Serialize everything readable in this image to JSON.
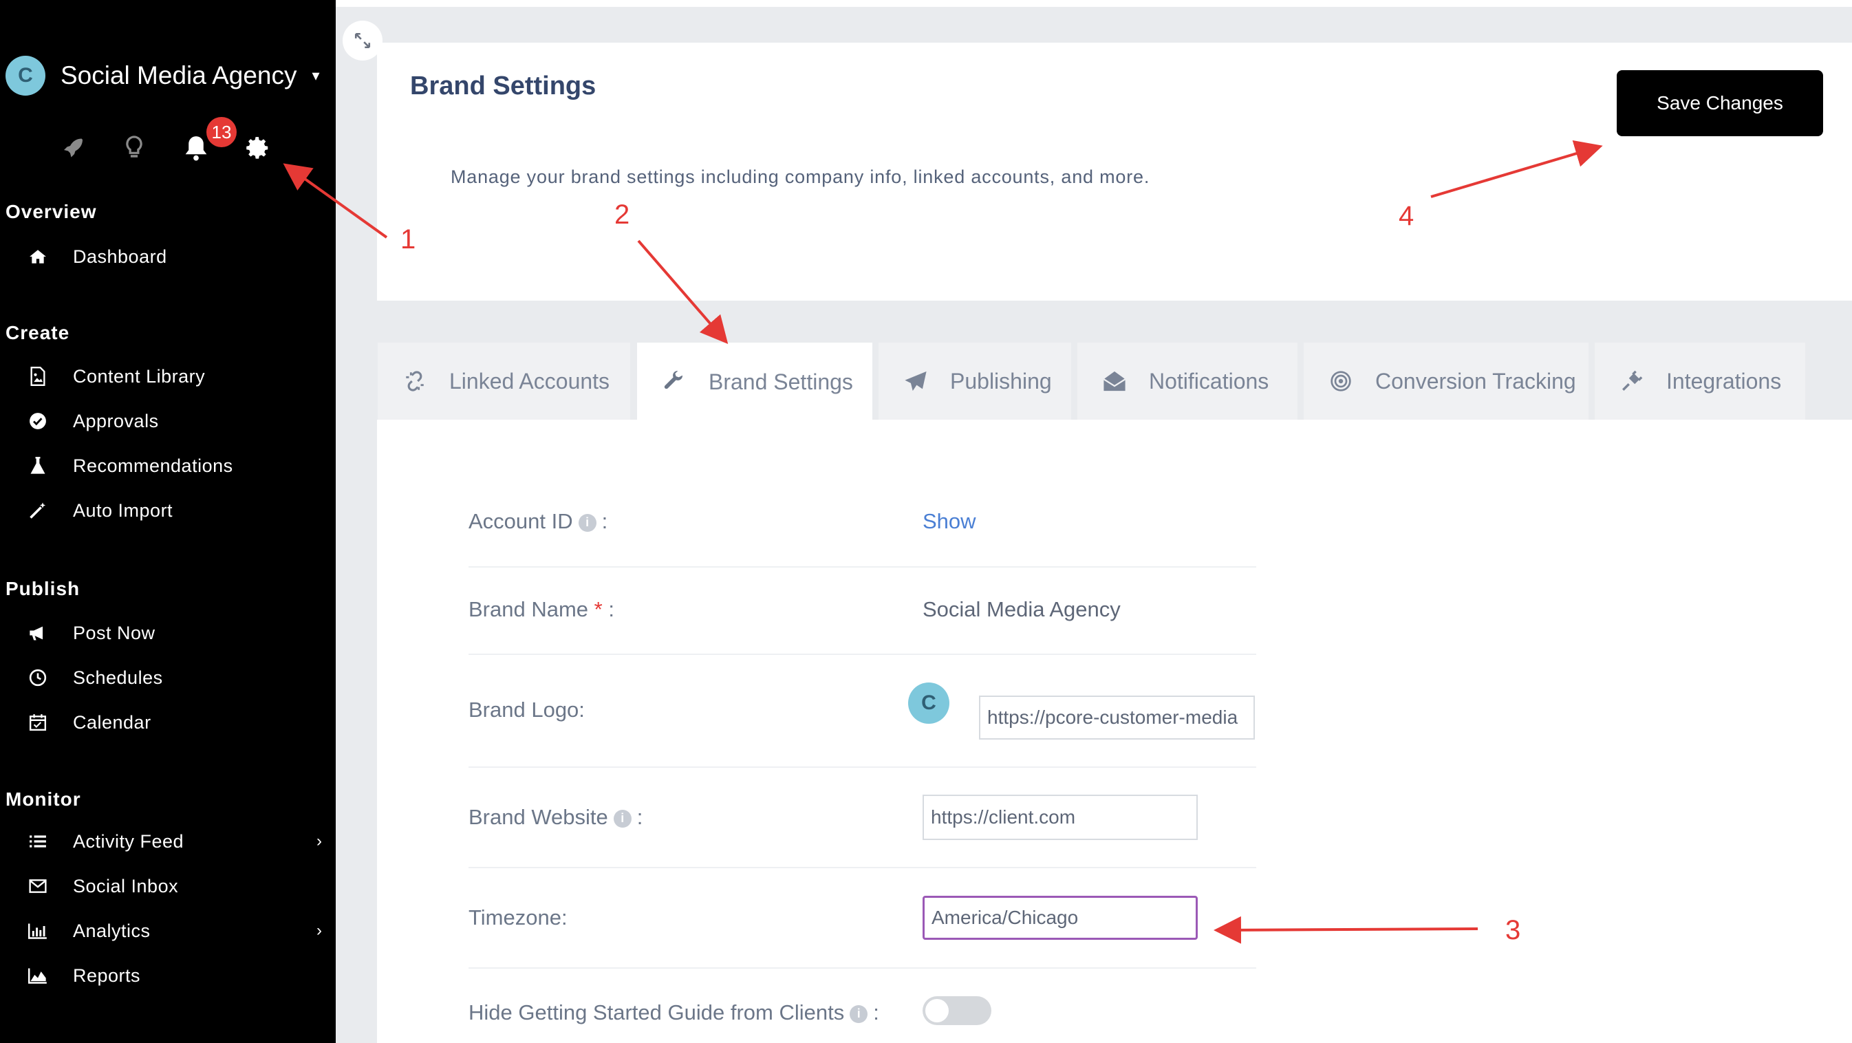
{
  "sidebar": {
    "brand": {
      "avatar_letter": "C",
      "name": "Social Media Agency",
      "caret": "▾"
    },
    "notification_count": "13",
    "sections": [
      {
        "title": "Overview",
        "items": [
          {
            "label": "Dashboard",
            "icon": "home-icon"
          }
        ]
      },
      {
        "title": "Create",
        "items": [
          {
            "label": "Content Library",
            "icon": "file-image-icon"
          },
          {
            "label": "Approvals",
            "icon": "check-circle-icon"
          },
          {
            "label": "Recommendations",
            "icon": "flask-icon"
          },
          {
            "label": "Auto Import",
            "icon": "magic-wand-icon"
          }
        ]
      },
      {
        "title": "Publish",
        "items": [
          {
            "label": "Post Now",
            "icon": "megaphone-icon"
          },
          {
            "label": "Schedules",
            "icon": "clock-icon"
          },
          {
            "label": "Calendar",
            "icon": "calendar-icon"
          }
        ]
      },
      {
        "title": "Monitor",
        "items": [
          {
            "label": "Activity Feed",
            "icon": "list-icon",
            "chevron": "›"
          },
          {
            "label": "Social Inbox",
            "icon": "envelope-icon"
          },
          {
            "label": "Analytics",
            "icon": "bar-chart-icon",
            "chevron": "›"
          },
          {
            "label": "Reports",
            "icon": "area-chart-icon"
          }
        ]
      }
    ]
  },
  "header": {
    "title": "Brand Settings",
    "description": "Manage your brand settings including company info, linked accounts, and more.",
    "save_label": "Save Changes"
  },
  "tabs": [
    {
      "label": "Linked Accounts",
      "icon": "unlink-icon"
    },
    {
      "label": "Brand Settings",
      "icon": "wrench-icon",
      "active": true
    },
    {
      "label": "Publishing",
      "icon": "paper-plane-icon"
    },
    {
      "label": "Notifications",
      "icon": "envelope-open-icon"
    },
    {
      "label": "Conversion Tracking",
      "icon": "target-icon"
    },
    {
      "label": "Integrations",
      "icon": "plug-icon"
    }
  ],
  "form": {
    "account_id": {
      "label": "Account ID",
      "suffix": ":",
      "value": "Show"
    },
    "brand_name": {
      "label": "Brand Name",
      "required": "*",
      "suffix": ":",
      "value": "Social Media Agency"
    },
    "brand_logo": {
      "label": "Brand Logo:",
      "avatar_letter": "C",
      "url": "https://pcore-customer-media"
    },
    "brand_website": {
      "label": "Brand Website",
      "suffix": ":",
      "value": "https://client.com"
    },
    "timezone": {
      "label": "Timezone:",
      "value": "America/Chicago"
    },
    "hide_guide": {
      "label": "Hide Getting Started Guide from Clients",
      "suffix": ":",
      "enabled": false
    }
  },
  "annotations": [
    "1",
    "2",
    "3",
    "4"
  ],
  "colors": {
    "accent": "#e53935",
    "link": "#4a7fd4",
    "title": "#34466b",
    "focus": "#9b59b6",
    "logo_avatar": "#7ec8dc"
  }
}
